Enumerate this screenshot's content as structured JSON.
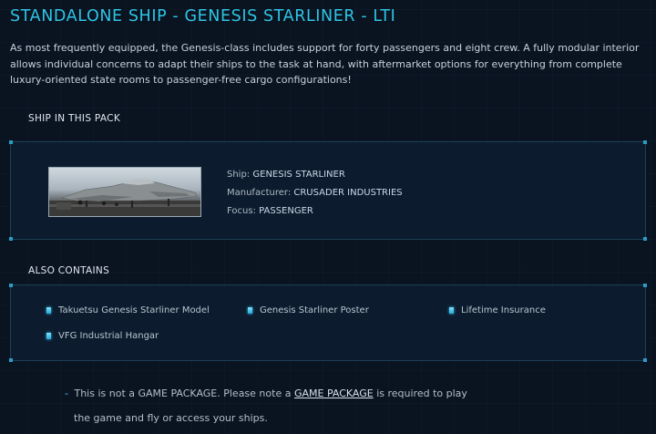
{
  "title": "STANDALONE SHIP - GENESIS STARLINER - LTI",
  "description": "As most frequently equipped, the Genesis-class includes support for forty passengers and eight crew. A fully modular interior allows individual concerns to adapt their ships to the task at hand, with aftermarket options for everything from complete luxury-oriented state rooms to passenger-free cargo configurations!",
  "ship_section": {
    "heading": "SHIP IN THIS PACK",
    "ship": {
      "ship_label": "Ship:",
      "ship_value": "GENESIS STARLINER",
      "manufacturer_label": "Manufacturer:",
      "manufacturer_value": "CRUSADER INDUSTRIES",
      "focus_label": "Focus:",
      "focus_value": "PASSENGER"
    }
  },
  "contains_section": {
    "heading": "ALSO CONTAINS",
    "items": [
      {
        "label": "Takuetsu Genesis Starliner Model"
      },
      {
        "label": "Genesis Starliner Poster"
      },
      {
        "label": "Lifetime Insurance"
      },
      {
        "label": "VFG Industrial Hangar"
      }
    ]
  },
  "notice": {
    "dash": "-",
    "text_before": "This is not a GAME PACKAGE. Please note a ",
    "link_text": "GAME PACKAGE",
    "text_after": " is required to play",
    "line2": "the game and fly or access your ships."
  },
  "colors": {
    "accent": "#2ec5e6",
    "background": "#0a1320",
    "panel_border": "#1d4058",
    "bullet": "#35bde8"
  }
}
